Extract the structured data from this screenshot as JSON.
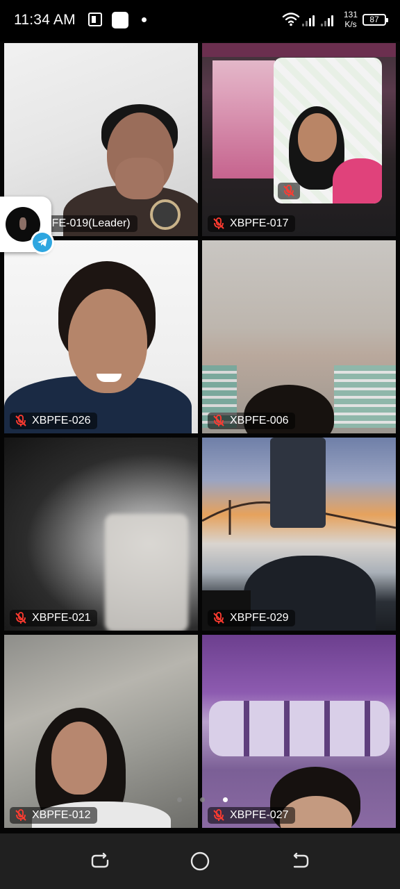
{
  "status_bar": {
    "time": "11:34 AM",
    "network_speed_value": "131",
    "network_speed_unit": "K/s",
    "battery": "87"
  },
  "participants": [
    {
      "name": "XBPFE-019(Leader)",
      "display_name": "PFE-019(Leader)",
      "muted": false
    },
    {
      "name": "XBPFE-017",
      "muted": true
    },
    {
      "name": "XBPFE-026",
      "muted": true
    },
    {
      "name": "XBPFE-006",
      "muted": true
    },
    {
      "name": "XBPFE-021",
      "muted": true
    },
    {
      "name": "XBPFE-029",
      "muted": true
    },
    {
      "name": "XBPFE-012",
      "muted": true
    },
    {
      "name": "XBPFE-027",
      "muted": true
    }
  ],
  "pager": {
    "pages": 3,
    "current": 3
  },
  "colors": {
    "muted_icon": "#ff3b30",
    "telegram_blue": "#2ea6e0",
    "nav_bar": "#202020"
  },
  "icons": {
    "muted": "mic-off-icon",
    "floating_app": "telegram-icon",
    "nav_recent": "recent-apps-icon",
    "nav_home": "home-icon",
    "nav_back": "back-icon"
  }
}
